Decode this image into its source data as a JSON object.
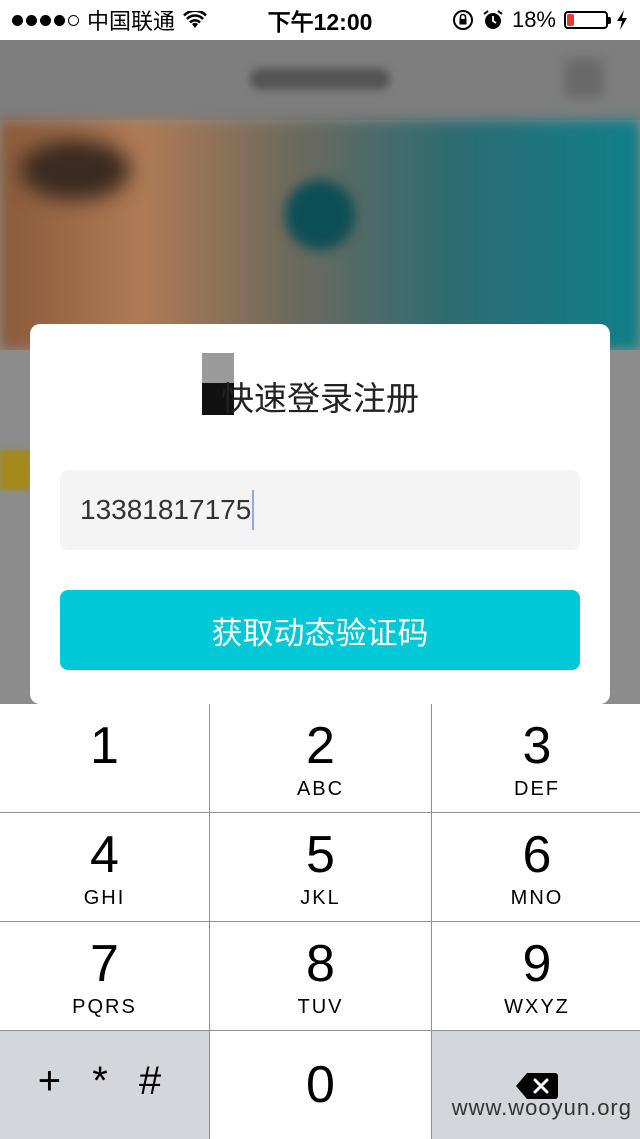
{
  "status_bar": {
    "carrier": "中国联通",
    "time": "下午12:00",
    "battery_percent": "18%",
    "battery_level": 0.18,
    "signal_dots_filled": 4,
    "signal_dots_total": 5,
    "icons": [
      "wifi-icon",
      "rotation-lock-icon",
      "alarm-icon",
      "battery-icon",
      "charging-icon"
    ]
  },
  "dialog": {
    "title": "快速登录注册",
    "phone_value": "13381817175",
    "button_label": "获取动态验证码",
    "button_color": "#00c8d6"
  },
  "keypad": {
    "keys": [
      {
        "num": "1",
        "letters": ""
      },
      {
        "num": "2",
        "letters": "ABC"
      },
      {
        "num": "3",
        "letters": "DEF"
      },
      {
        "num": "4",
        "letters": "GHI"
      },
      {
        "num": "5",
        "letters": "JKL"
      },
      {
        "num": "6",
        "letters": "MNO"
      },
      {
        "num": "7",
        "letters": "PQRS"
      },
      {
        "num": "8",
        "letters": "TUV"
      },
      {
        "num": "9",
        "letters": "WXYZ"
      }
    ],
    "symbols": "+ * #",
    "zero": "0"
  },
  "watermark": "www.wooyun.org"
}
